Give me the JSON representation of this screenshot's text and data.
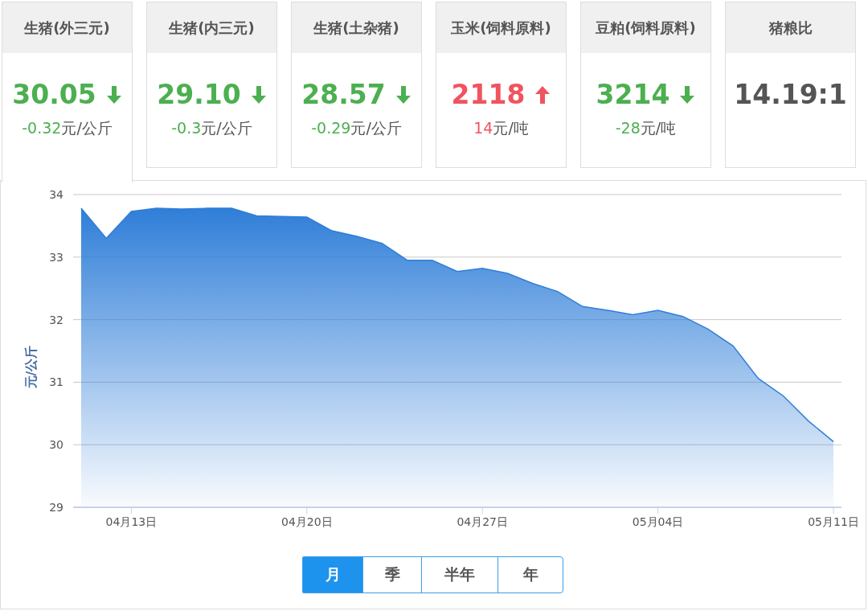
{
  "cards": [
    {
      "title": "生猪(外三元)",
      "value": "30.05",
      "kind": "down",
      "change": "-0.32",
      "unit": "元/公斤",
      "selected": true
    },
    {
      "title": "生猪(内三元)",
      "value": "29.10",
      "kind": "down",
      "change": "-0.3",
      "unit": "元/公斤",
      "selected": false
    },
    {
      "title": "生猪(土杂猪)",
      "value": "28.57",
      "kind": "down",
      "change": "-0.29",
      "unit": "元/公斤",
      "selected": false
    },
    {
      "title": "玉米(饲料原料)",
      "value": "2118",
      "kind": "up",
      "change": "14",
      "unit": "元/吨",
      "selected": false
    },
    {
      "title": "豆粕(饲料原料)",
      "value": "3214",
      "kind": "down",
      "change": "-28",
      "unit": "元/吨",
      "selected": false
    },
    {
      "title": "猪粮比",
      "value": "14.19:1",
      "kind": "flat",
      "selected": false
    }
  ],
  "chart": {
    "chart_data": {
      "type": "area",
      "ylabel": "元/公斤",
      "grid": true,
      "categories": [
        null,
        null,
        "04月13日",
        null,
        null,
        null,
        null,
        null,
        null,
        "04月20日",
        null,
        null,
        null,
        null,
        null,
        null,
        "04月27日",
        null,
        null,
        null,
        null,
        null,
        null,
        "05月04日",
        null,
        null,
        null,
        null,
        null,
        null,
        "05月11日"
      ],
      "series": [
        {
          "color": "#2f7ed8",
          "values": [
            33.78,
            33.3,
            33.73,
            33.78,
            33.77,
            33.78,
            33.78,
            33.66,
            33.65,
            33.64,
            33.42,
            33.33,
            33.22,
            32.95,
            32.95,
            32.77,
            32.82,
            32.74,
            32.58,
            32.45,
            32.21,
            32.15,
            32.08,
            32.15,
            32.05,
            31.85,
            31.58,
            31.06,
            30.78,
            30.38,
            30.05
          ]
        }
      ],
      "ylim": [
        29,
        34
      ],
      "yticks": [
        29,
        30,
        31,
        32,
        33,
        34
      ]
    }
  },
  "ranges": [
    {
      "label": "月",
      "selected": true
    },
    {
      "label": "季",
      "selected": false
    },
    {
      "label": "半年",
      "selected": false
    },
    {
      "label": "年",
      "selected": false
    }
  ]
}
